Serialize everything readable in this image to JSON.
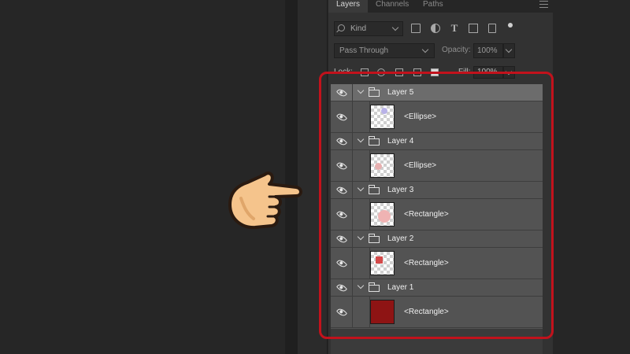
{
  "panel": {
    "tabs": [
      {
        "label": "Layers",
        "active": true
      },
      {
        "label": "Channels",
        "active": false
      },
      {
        "label": "Paths",
        "active": false
      }
    ]
  },
  "filter": {
    "kind_label": "Kind",
    "icons": [
      "image-filter-icon",
      "adjustment-filter-icon",
      "type-filter-icon",
      "shape-filter-icon",
      "smart-object-filter-icon"
    ]
  },
  "blend": {
    "mode": "Pass Through",
    "opacity_label": "Opacity:",
    "opacity_value": "100%"
  },
  "lock": {
    "label": "Lock:",
    "fill_label": "Fill:",
    "fill_value": "100%"
  },
  "layers": [
    {
      "group": "Layer 5",
      "child": "<Ellipse>",
      "selected": true,
      "thumb": {
        "shape": "ellipse",
        "color": "#b9b2e8"
      }
    },
    {
      "group": "Layer 4",
      "child": "<Ellipse>",
      "selected": false,
      "thumb": {
        "shape": "ellipse",
        "color": "#e7b0b0"
      }
    },
    {
      "group": "Layer 3",
      "child": "<Rectangle>",
      "selected": false,
      "thumb": {
        "shape": "circle",
        "color": "#efb3b3"
      }
    },
    {
      "group": "Layer 2",
      "child": "<Rectangle>",
      "selected": false,
      "thumb": {
        "shape": "square",
        "color": "#d44a4a"
      }
    },
    {
      "group": "Layer 1",
      "child": "<Rectangle>",
      "selected": false,
      "thumb": {
        "shape": "fill",
        "color": "#8e1414"
      }
    }
  ],
  "colors": {
    "highlight": "#c2121c",
    "selected_row": "#6c6c6c"
  }
}
